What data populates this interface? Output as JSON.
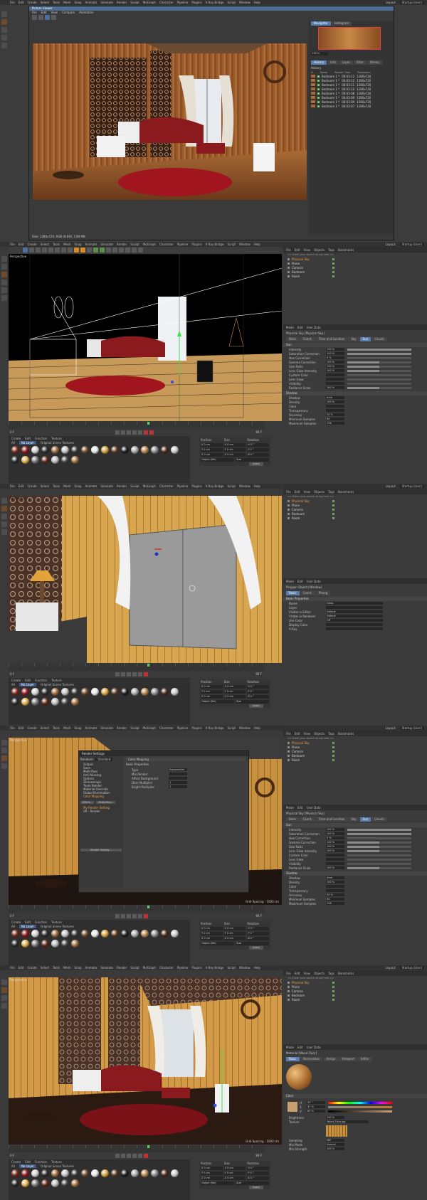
{
  "menu": [
    "File",
    "Edit",
    "Create",
    "Select",
    "Tools",
    "Mesh",
    "Snap",
    "Animate",
    "Simulate",
    "Render",
    "Sculpt",
    "MoGraph",
    "Character",
    "Pipeline",
    "Plugins",
    "V-Ray Bridge",
    "Script",
    "Window",
    "Help"
  ],
  "right_menu": [
    "File",
    "Edit",
    "View",
    "Objects",
    "Tags",
    "Bookmarks"
  ],
  "layout_label": "Layout:",
  "layout_value": "Startup (User)",
  "viewport_label": "Perspective",
  "picture_viewer": {
    "title": "Picture Viewer",
    "menu": [
      "File",
      "Edit",
      "View",
      "Compare",
      "Animation"
    ],
    "nav_tabs": [
      "Navigator",
      "Histogram"
    ],
    "zoom": "136 %",
    "history_tabs": [
      "History",
      "Info",
      "Layer",
      "Filter",
      "Stereo"
    ],
    "history_label": "History",
    "history_cols": [
      "#",
      "Name",
      "Render Time",
      "Resolution"
    ],
    "history_rows": [
      {
        "name": "Bedroom 1 *",
        "time": "00:03:12",
        "res": "1280x720"
      },
      {
        "name": "Bedroom 1 *",
        "time": "00:03:12",
        "res": "1280x720"
      },
      {
        "name": "Bedroom 1 *",
        "time": "00:03:11",
        "res": "1280x720"
      },
      {
        "name": "Bedroom 1 *",
        "time": "00:03:10",
        "res": "1280x720"
      },
      {
        "name": "Bedroom 1 *",
        "time": "00:03:08",
        "res": "1280x720"
      },
      {
        "name": "Bedroom 1 *",
        "time": "00:03:09",
        "res": "1280x720"
      },
      {
        "name": "Bedroom 1 *",
        "time": "00:03:09",
        "res": "1280x720"
      },
      {
        "name": "Bedroom 1 *",
        "time": "00:03:07",
        "res": "1280x720"
      }
    ],
    "status": "Size: 1280x720, RGB (8 Bit), 7,80 MB"
  },
  "objects": {
    "search": "<< Enter your search string here >>",
    "tree": [
      "Physical Sky",
      "Plane",
      "Camera",
      "Bedroom",
      "Room"
    ]
  },
  "attributes": {
    "menu": [
      "Mode",
      "Edit",
      "User Data"
    ],
    "title": "Physical Sky [Physical Sky]",
    "tabs": [
      "Basic",
      "Coord.",
      "Time and Location",
      "Sky",
      "Sun",
      "Clouds"
    ],
    "sun_props_label": "Sun",
    "sun_rows": [
      {
        "label": "Intensity",
        "value": "100 %",
        "fill": 100
      },
      {
        "label": "Saturation Correction",
        "value": "100 %",
        "fill": 100
      },
      {
        "label": "Hue Correction",
        "value": "0 %",
        "fill": 0
      },
      {
        "label": "Gamma Correction",
        "value": "100 %",
        "fill": 50
      },
      {
        "label": "Size Ratio",
        "value": "100 %",
        "fill": 50
      },
      {
        "label": "Lens Glow Intensity",
        "value": "100 %",
        "fill": 50
      },
      {
        "label": "Custom Color",
        "value": "",
        "fill": 0
      },
      {
        "label": "Lens Glow",
        "value": "",
        "fill": 0
      },
      {
        "label": "Visibility",
        "value": "",
        "fill": 0
      },
      {
        "label": "Radiance Scale",
        "value": "100 %",
        "fill": 50
      }
    ],
    "shadow_label": "Shadow",
    "shadow_rows": [
      {
        "label": "Shadow",
        "value": "Area"
      },
      {
        "label": "Density",
        "value": "100 %"
      },
      {
        "label": "Color",
        "value": ""
      },
      {
        "label": "Transparency",
        "value": ""
      },
      {
        "label": "Accuracy",
        "value": "50 %"
      },
      {
        "label": "Minimum Samples",
        "value": "64"
      },
      {
        "label": "Maximum Samples",
        "value": "256"
      }
    ]
  },
  "polygon_attr": {
    "title": "Polygon Object [Window]",
    "tabs": [
      "Basic",
      "Coord.",
      "Phong"
    ],
    "section": "Basic Properties",
    "rows": [
      {
        "label": "Name",
        "value": "Glass"
      },
      {
        "label": "Layer",
        "value": ""
      },
      {
        "label": "Visible in Editor",
        "value": "Default"
      },
      {
        "label": "Visible in Renderer",
        "value": "Default"
      },
      {
        "label": "Use Color",
        "value": "Off"
      },
      {
        "label": "Display Color",
        "value": ""
      },
      {
        "label": "X-Ray",
        "value": ""
      }
    ]
  },
  "render_settings": {
    "title": "Render Settings",
    "renderer_label": "Renderer",
    "renderer_value": "Standard",
    "items": [
      "Output",
      "Save",
      "Multi-Pass",
      "Anti-Aliasing",
      "Options",
      "Stereoscopic",
      "Team Render",
      "Material Override",
      "Global Illumination",
      "Color Mapping"
    ],
    "active_item": "Color Mapping",
    "right_title": "Color Mapping",
    "props_label": "Basic Properties",
    "props": [
      {
        "label": "Type",
        "value": "Exponential"
      },
      {
        "label": "Mix Render",
        "value": ""
      },
      {
        "label": "Affect Background",
        "value": ""
      },
      {
        "label": "Dark Multiplier",
        "value": "1"
      },
      {
        "label": "Bright Multiplier",
        "value": "1"
      }
    ],
    "effect_btn": "Effect...",
    "multipass_btn": "Multi-Pass...",
    "setting_items": [
      "My Render Setting",
      "VR - Render"
    ],
    "bottom_btn": "Render Setting..."
  },
  "material_editor": {
    "title": "Material [Wood Floor]",
    "tabs": [
      "Basic",
      "Illumination",
      "Assign",
      "Viewport",
      "Editor"
    ],
    "color_label": "Color",
    "brightness_label": "Brightness",
    "brightness_value": "100 %",
    "texture_label": "Texture",
    "texture_value": "Wood_Floor.jpg",
    "sampling_label": "Sampling",
    "sampling_value": "MIP",
    "mix_mode_label": "Mix Mode",
    "mix_mode_value": "Normal",
    "mix_strength_label": "Mix Strength",
    "mix_strength_value": "100 %",
    "h_label": "H",
    "s_label": "S",
    "v_label": "V",
    "h_value": "35 °",
    "s_value": "31 %",
    "v_value": "80 %"
  },
  "material_bar": {
    "menu": [
      "Create",
      "Edit",
      "Function",
      "Texture"
    ],
    "filters": [
      "All",
      "No Layer",
      "Original Scene Textures"
    ]
  },
  "timeline": {
    "start": "0 F",
    "end": "90 F",
    "current": "0 F"
  },
  "coords": {
    "headers": [
      "Position",
      "Size",
      "Rotation"
    ],
    "rows": [
      [
        "X  0 cm",
        "X  0 cm",
        "H  0 °"
      ],
      [
        "Y  0 cm",
        "Y  0 cm",
        "P  0 °"
      ],
      [
        "Z  0 cm",
        "Z  0 cm",
        "B  0 °"
      ]
    ],
    "mode": "Object (Rel)",
    "size_mode": "Size",
    "apply": "Apply"
  },
  "grid_spacing": "Grid Spacing : 1000 cm",
  "colors": {
    "accent": "#5a7db0",
    "orange": "#f0a04b",
    "wood": "#c68a45",
    "red": "#8b1a1e"
  },
  "materials": [
    "#7a2a1e",
    "#8a1a1a",
    "#cfcfcf",
    "#2e2e2e",
    "#9b6b3a",
    "#c0c0c0",
    "#3a3a3a",
    "#6b4a2a",
    "#e6e6e6",
    "#d4a140",
    "#5a3a22",
    "#1e1e1e",
    "#a7a7a7",
    "#b5844a",
    "#8a8a8a",
    "#4a2a1a",
    "#c9c9c9",
    "#2a2a2a",
    "#e0b050",
    "#777",
    "#5c2a1a",
    "#bbb",
    "#444",
    "#a07040"
  ]
}
